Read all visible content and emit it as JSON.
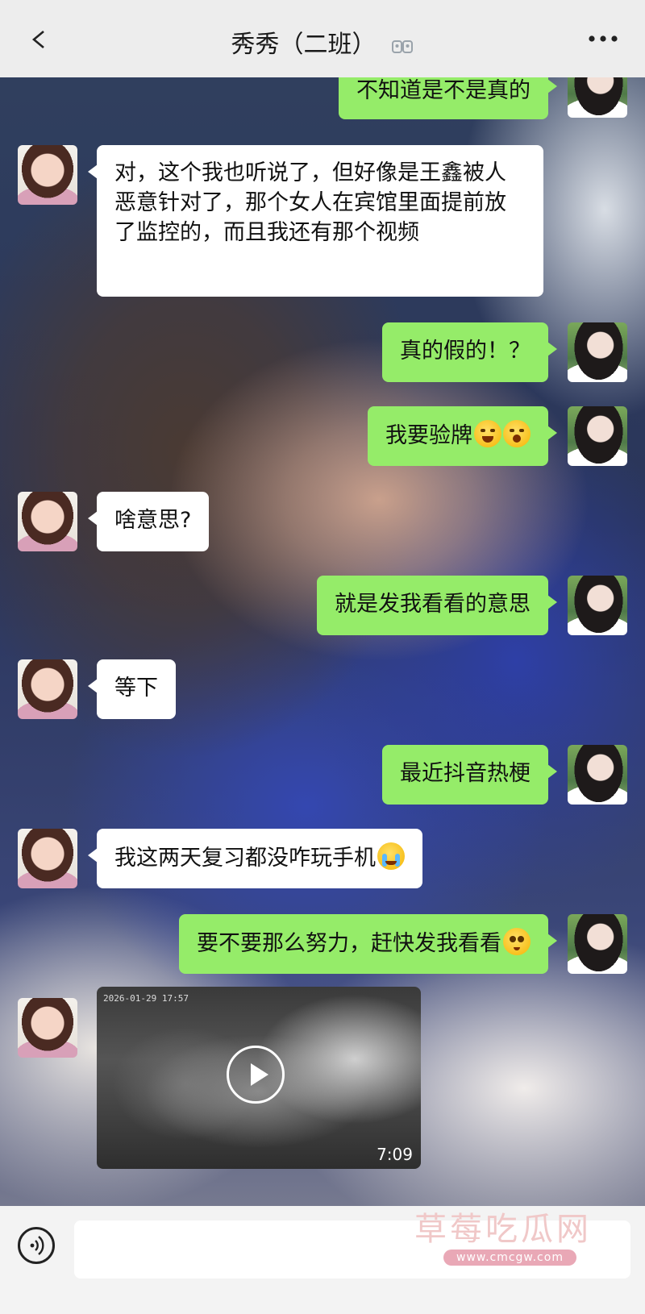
{
  "header": {
    "title": "秀秀（二班）",
    "back_icon": "chevron-left-icon",
    "group_icon": "group-icon",
    "more_icon": "ellipsis-icon"
  },
  "messages": [
    {
      "side": "right",
      "text": "不知道是不是真的"
    },
    {
      "side": "left",
      "text": "对，这个我也听说了，但好像是王鑫被人恶意针对了，那个女人在宾馆里面提前放了监控的，而且我还有那个视频"
    },
    {
      "side": "right",
      "text": "真的假的！？"
    },
    {
      "side": "right",
      "text": "我要验牌",
      "emoji": [
        "laughing-tears-emoji",
        "dizzy-face-emoji"
      ]
    },
    {
      "side": "left",
      "text": "啥意思?"
    },
    {
      "side": "right",
      "text": "就是发我看看的意思"
    },
    {
      "side": "left",
      "text": "等下"
    },
    {
      "side": "right",
      "text": "最近抖音热梗"
    },
    {
      "side": "left",
      "text": "我这两天复习都没咋玩手机",
      "emoji": [
        "crying-face-emoji"
      ]
    },
    {
      "side": "right",
      "text": "要不要那么努力，赶快发我看看",
      "emoji": [
        "pleading-face-emoji"
      ]
    },
    {
      "side": "left",
      "type": "video",
      "timestamp": "2026-01-29 17:57",
      "duration": "7:09"
    }
  ],
  "footer": {
    "voice_icon": "voice-icon",
    "input_value": "",
    "watermark_text": "草莓吃瓜网",
    "watermark_url": "www.cmcgw.com"
  },
  "colors": {
    "header_bg": "#ededed",
    "bubble_green": "#95ec69",
    "bubble_white": "#ffffff",
    "footer_bg": "#f3f3f3"
  }
}
